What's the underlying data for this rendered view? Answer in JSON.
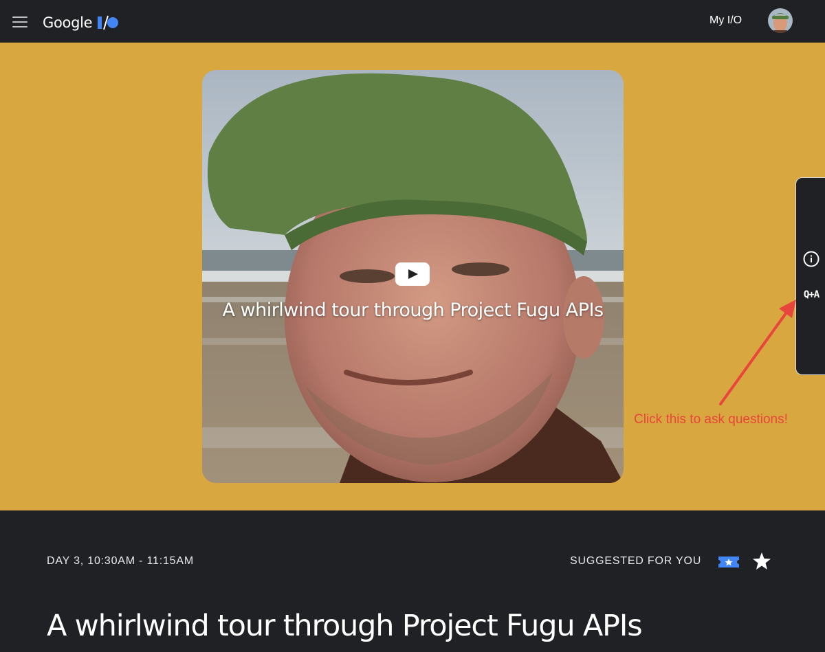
{
  "header": {
    "brand_name": "Google",
    "my_io_label": "My I/O",
    "menu_icon": "hamburger-menu-icon",
    "logo_icon": "io-logo-icon",
    "avatar_icon": "user-avatar"
  },
  "video": {
    "title": "A whirlwind tour through Project Fugu APIs",
    "play_icon": "youtube-play-icon"
  },
  "side_panel": {
    "info_icon": "info-icon",
    "qa_label": "Q+A"
  },
  "annotation": {
    "text": "Click this to ask questions!",
    "color": "#e8453c"
  },
  "session": {
    "time": "DAY 3, 10:30AM - 11:15AM",
    "suggested_label": "SUGGESTED FOR YOU",
    "ticket_icon": "ticket-star-icon",
    "star_icon": "star-icon",
    "title": "A whirlwind tour through Project Fugu APIs"
  },
  "colors": {
    "background": "#202124",
    "hero": "#d9a73f",
    "accent_blue": "#4285f4",
    "annotation_red": "#e8453c"
  }
}
